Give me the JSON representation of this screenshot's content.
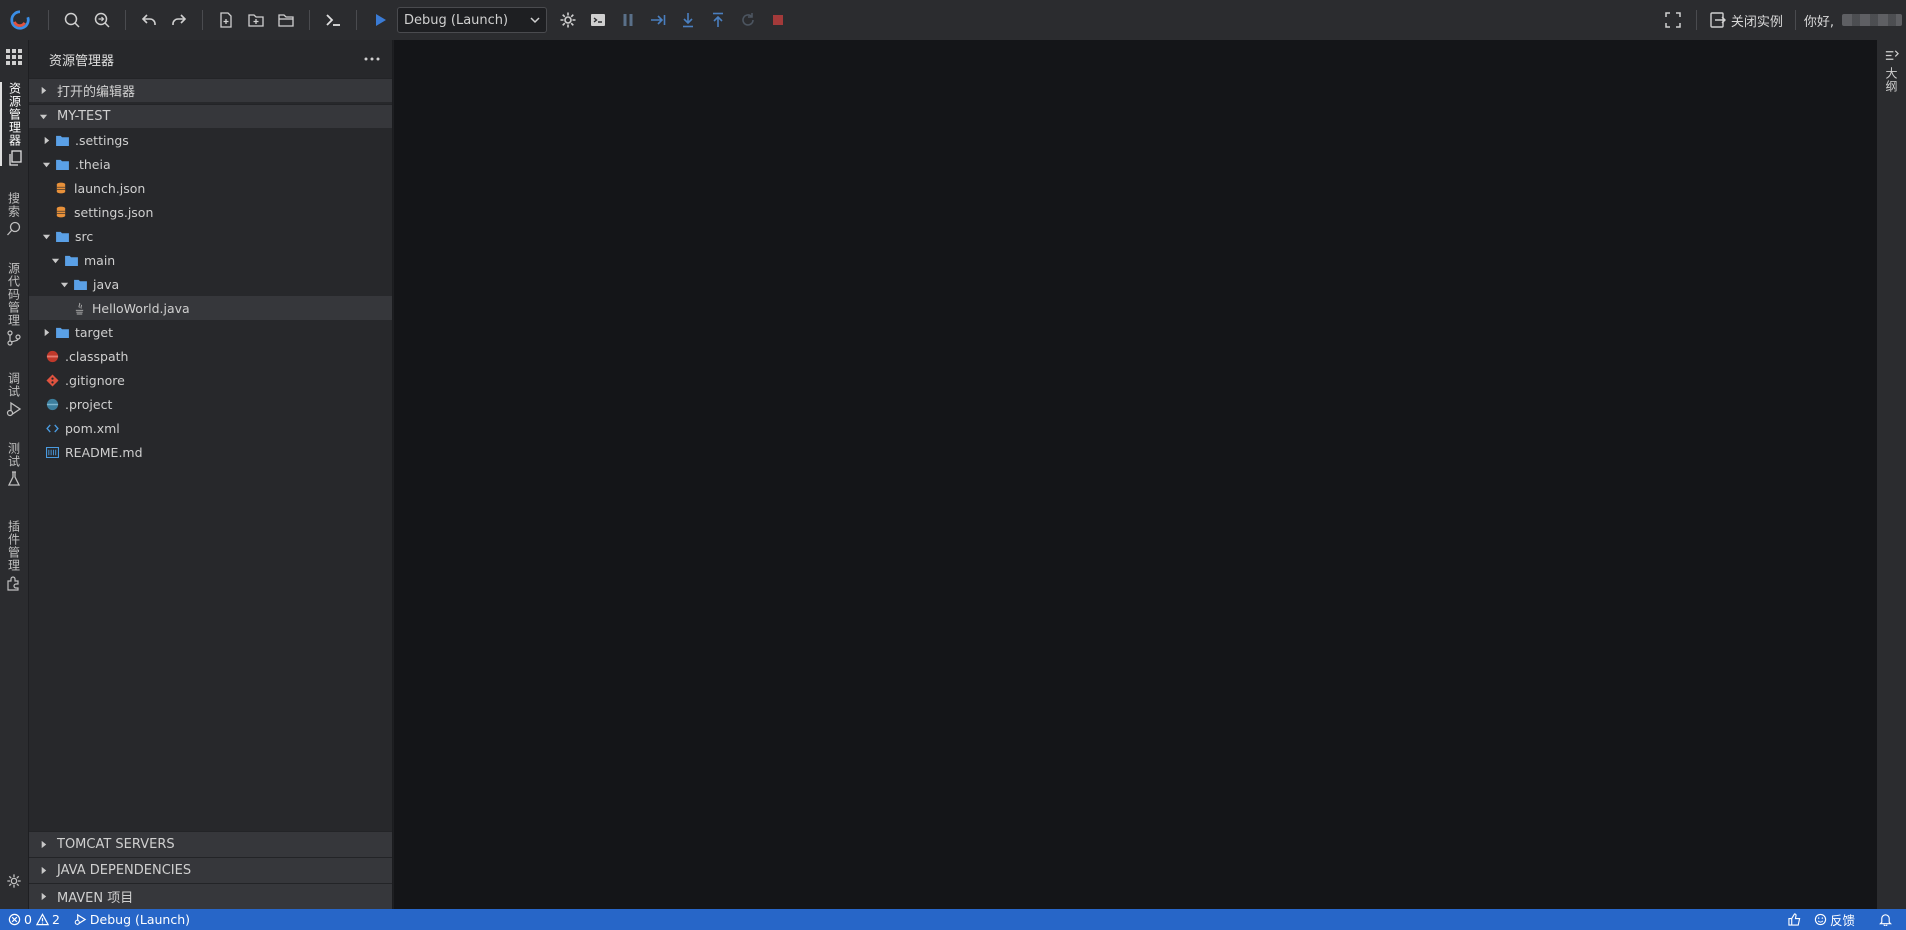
{
  "toolbar": {
    "debug_config": "Debug (Launch)",
    "close_instance": "关闭实例",
    "greeting": "你好,"
  },
  "activity": {
    "explorer": "资源管理器",
    "search": "搜索",
    "source_control": "源代码管理",
    "debug": "调试",
    "testing": "测试",
    "extensions": "插件管理"
  },
  "explorer": {
    "title": "资源管理器",
    "open_editors": "打开的编辑器",
    "project": "MY-TEST",
    "tree": [
      {
        "label": ".settings",
        "depth": 0,
        "kind": "folder",
        "expanded": false
      },
      {
        "label": ".theia",
        "depth": 0,
        "kind": "folder",
        "expanded": true
      },
      {
        "label": "launch.json",
        "depth": 1,
        "kind": "json"
      },
      {
        "label": "settings.json",
        "depth": 1,
        "kind": "json"
      },
      {
        "label": "src",
        "depth": 0,
        "kind": "folder",
        "expanded": true
      },
      {
        "label": "main",
        "depth": 1,
        "kind": "folder",
        "expanded": true
      },
      {
        "label": "java",
        "depth": 2,
        "kind": "folder",
        "expanded": true
      },
      {
        "label": "HelloWorld.java",
        "depth": 3,
        "kind": "java",
        "selected": true
      },
      {
        "label": "target",
        "depth": 0,
        "kind": "folder",
        "expanded": false
      },
      {
        "label": ".classpath",
        "depth": 0,
        "kind": "classpath"
      },
      {
        "label": ".gitignore",
        "depth": 0,
        "kind": "git"
      },
      {
        "label": ".project",
        "depth": 0,
        "kind": "project"
      },
      {
        "label": "pom.xml",
        "depth": 0,
        "kind": "xml"
      },
      {
        "label": "README.md",
        "depth": 0,
        "kind": "md"
      }
    ],
    "bottom_sections": [
      "TOMCAT SERVERS",
      "JAVA DEPENDENCIES",
      "MAVEN 项目"
    ]
  },
  "rightbar": {
    "outline": "大纲"
  },
  "statusbar": {
    "errors": "0",
    "warnings": "2",
    "debug": "Debug (Launch)",
    "feedback": "反馈"
  },
  "colors": {
    "accent": "#2766c8",
    "folder": "#5aa0e6",
    "json": "#e8913a",
    "git": "#e0533f"
  }
}
